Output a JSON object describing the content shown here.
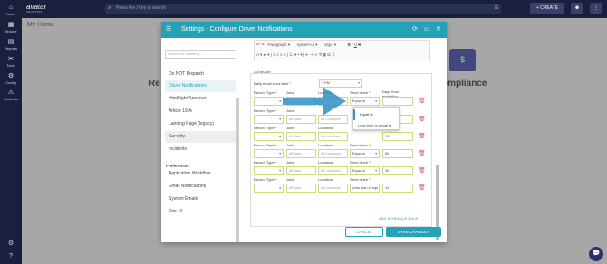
{
  "nav": {
    "items": [
      {
        "label": "Home",
        "icon": "home-icon"
      },
      {
        "label": "Browse",
        "icon": "browse-icon"
      },
      {
        "label": "Reports",
        "icon": "reports-icon"
      },
      {
        "label": "Tools",
        "icon": "tools-icon"
      },
      {
        "label": "Config",
        "icon": "config-icon"
      },
      {
        "label": "Incidents",
        "icon": "incidents-icon"
      }
    ]
  },
  "topbar": {
    "logo": "avatar",
    "logo_sub": "SOLUTIONS",
    "search_placeholder": "Press the / key to search",
    "create_label": "+ CREATE"
  },
  "page": {
    "title": "My Home",
    "bg_left": "Re",
    "bg_right": "ompliance"
  },
  "modal": {
    "title": "Settings - Configure Driver Notifications",
    "sidebar": {
      "search_placeholder": "Search for a setting...",
      "items": [
        "Do NOT Dispatch",
        "Driver Notifications",
        "HireRight Services",
        "Article 19-A",
        "Landing Page (legacy)",
        "Security",
        "Incidents"
      ],
      "preferences_heading": "Preferences",
      "preferences": [
        "Application Workflow",
        "Email Notifications",
        "System Emails",
        "Site UI"
      ]
    },
    "toolbar": {
      "row1": [
        "Paragraph",
        "system-ui",
        "16px"
      ],
      "format_icons": [
        "bold-icon",
        "italic-icon",
        "underline-icon",
        "strikethrough-icon"
      ]
    },
    "schedule": {
      "label": "Schedule",
      "daily_label": "Daily email send time *",
      "daily_value": "3 PM",
      "record_type_label": "Record Type *",
      "jobs_label": "Jobs",
      "locations_label": "Locations",
      "send_when_label": "Send when *",
      "days_label": "Days from expiration *",
      "all_jobs": "All Jobs",
      "all_locations": "All Locations",
      "rows": [
        {
          "send_when": "Equal to",
          "days": ""
        },
        {
          "send_when": "",
          "days": ""
        },
        {
          "send_when": "",
          "days": "15"
        },
        {
          "send_when": "Equal to",
          "days": "60"
        },
        {
          "send_when": "Equal to",
          "days": "30"
        },
        {
          "send_when": "Less than or equ",
          "days": "14"
        }
      ],
      "add_rule": "ADD SCHEDULE RULE"
    },
    "dropdown": {
      "options": [
        "Equal to",
        "Less than or equal to"
      ]
    },
    "cancel_label": "CANCEL",
    "save_label": "SAVE CHANGES"
  }
}
